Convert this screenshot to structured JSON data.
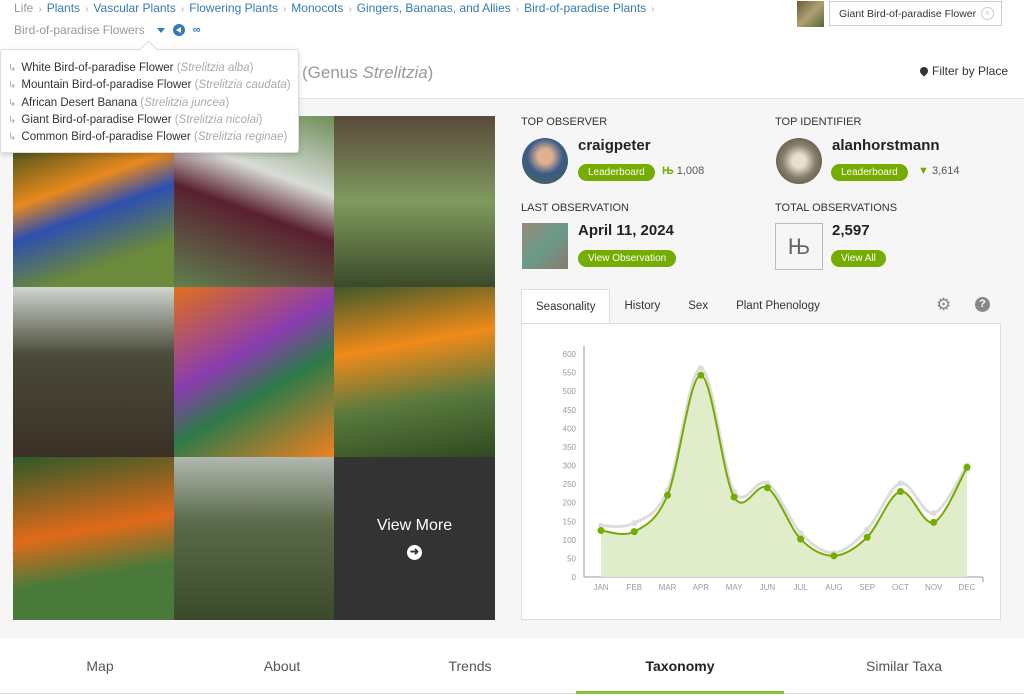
{
  "breadcrumbs": {
    "items": [
      "Life",
      "Plants",
      "Vascular Plants",
      "Flowering Plants",
      "Monocots",
      "Gingers, Bananas, and Allies",
      "Bird-of-paradise Plants"
    ],
    "current": "Bird-of-paradise Flowers"
  },
  "dropdown": {
    "items": [
      {
        "common": "White Bird-of-paradise Flower",
        "sci": "Strelitzia alba"
      },
      {
        "common": "Mountain Bird-of-paradise Flower",
        "sci": "Strelitzia caudata"
      },
      {
        "common": "African Desert Banana",
        "sci": "Strelitzia juncea"
      },
      {
        "common": "Giant Bird-of-paradise Flower",
        "sci": "Strelitzia nicolai"
      },
      {
        "common": "Common Bird-of-paradise Flower",
        "sci": "Strelitzia reginae"
      }
    ]
  },
  "title": {
    "prefix": "(Genus ",
    "genus": "Strelitzia",
    "suffix": ")"
  },
  "search": {
    "value": "Giant Bird-of-paradise Flower"
  },
  "filter_label": "Filter by Place",
  "photos": {
    "view_more": "View More"
  },
  "stats": {
    "top_observer": {
      "label": "TOP OBSERVER",
      "name": "craigpeter",
      "button": "Leaderboard",
      "count": "1,008"
    },
    "top_identifier": {
      "label": "TOP IDENTIFIER",
      "name": "alanhorstmann",
      "button": "Leaderboard",
      "count": "3,614"
    },
    "last_observation": {
      "label": "LAST OBSERVATION",
      "date": "April 11, 2024",
      "button": "View Observation"
    },
    "total_observations": {
      "label": "TOTAL OBSERVATIONS",
      "count": "2,597",
      "button": "View All"
    }
  },
  "chart_tabs": [
    "Seasonality",
    "History",
    "Sex",
    "Plant Phenology"
  ],
  "bottom_tabs": [
    "Map",
    "About",
    "Trends",
    "Taxonomy",
    "Similar Taxa"
  ],
  "colors": {
    "accent": "#74ac00",
    "link": "#337ab7"
  },
  "chart_data": {
    "type": "area",
    "categories": [
      "JAN",
      "FEB",
      "MAR",
      "APR",
      "MAY",
      "JUN",
      "JUL",
      "AUG",
      "SEP",
      "OCT",
      "NOV",
      "DEC"
    ],
    "yticks": [
      0,
      50,
      100,
      150,
      200,
      250,
      300,
      350,
      400,
      450,
      500,
      550,
      600
    ],
    "ylim": [
      0,
      600
    ],
    "series": [
      {
        "values": [
          138,
          145,
          233,
          562,
          230,
          252,
          118,
          65,
          127,
          252,
          172,
          300
        ],
        "color": "#dddddd"
      },
      {
        "values": [
          125,
          122,
          220,
          543,
          215,
          240,
          102,
          57,
          107,
          230,
          147,
          295
        ],
        "color": "#74ac00"
      }
    ]
  }
}
